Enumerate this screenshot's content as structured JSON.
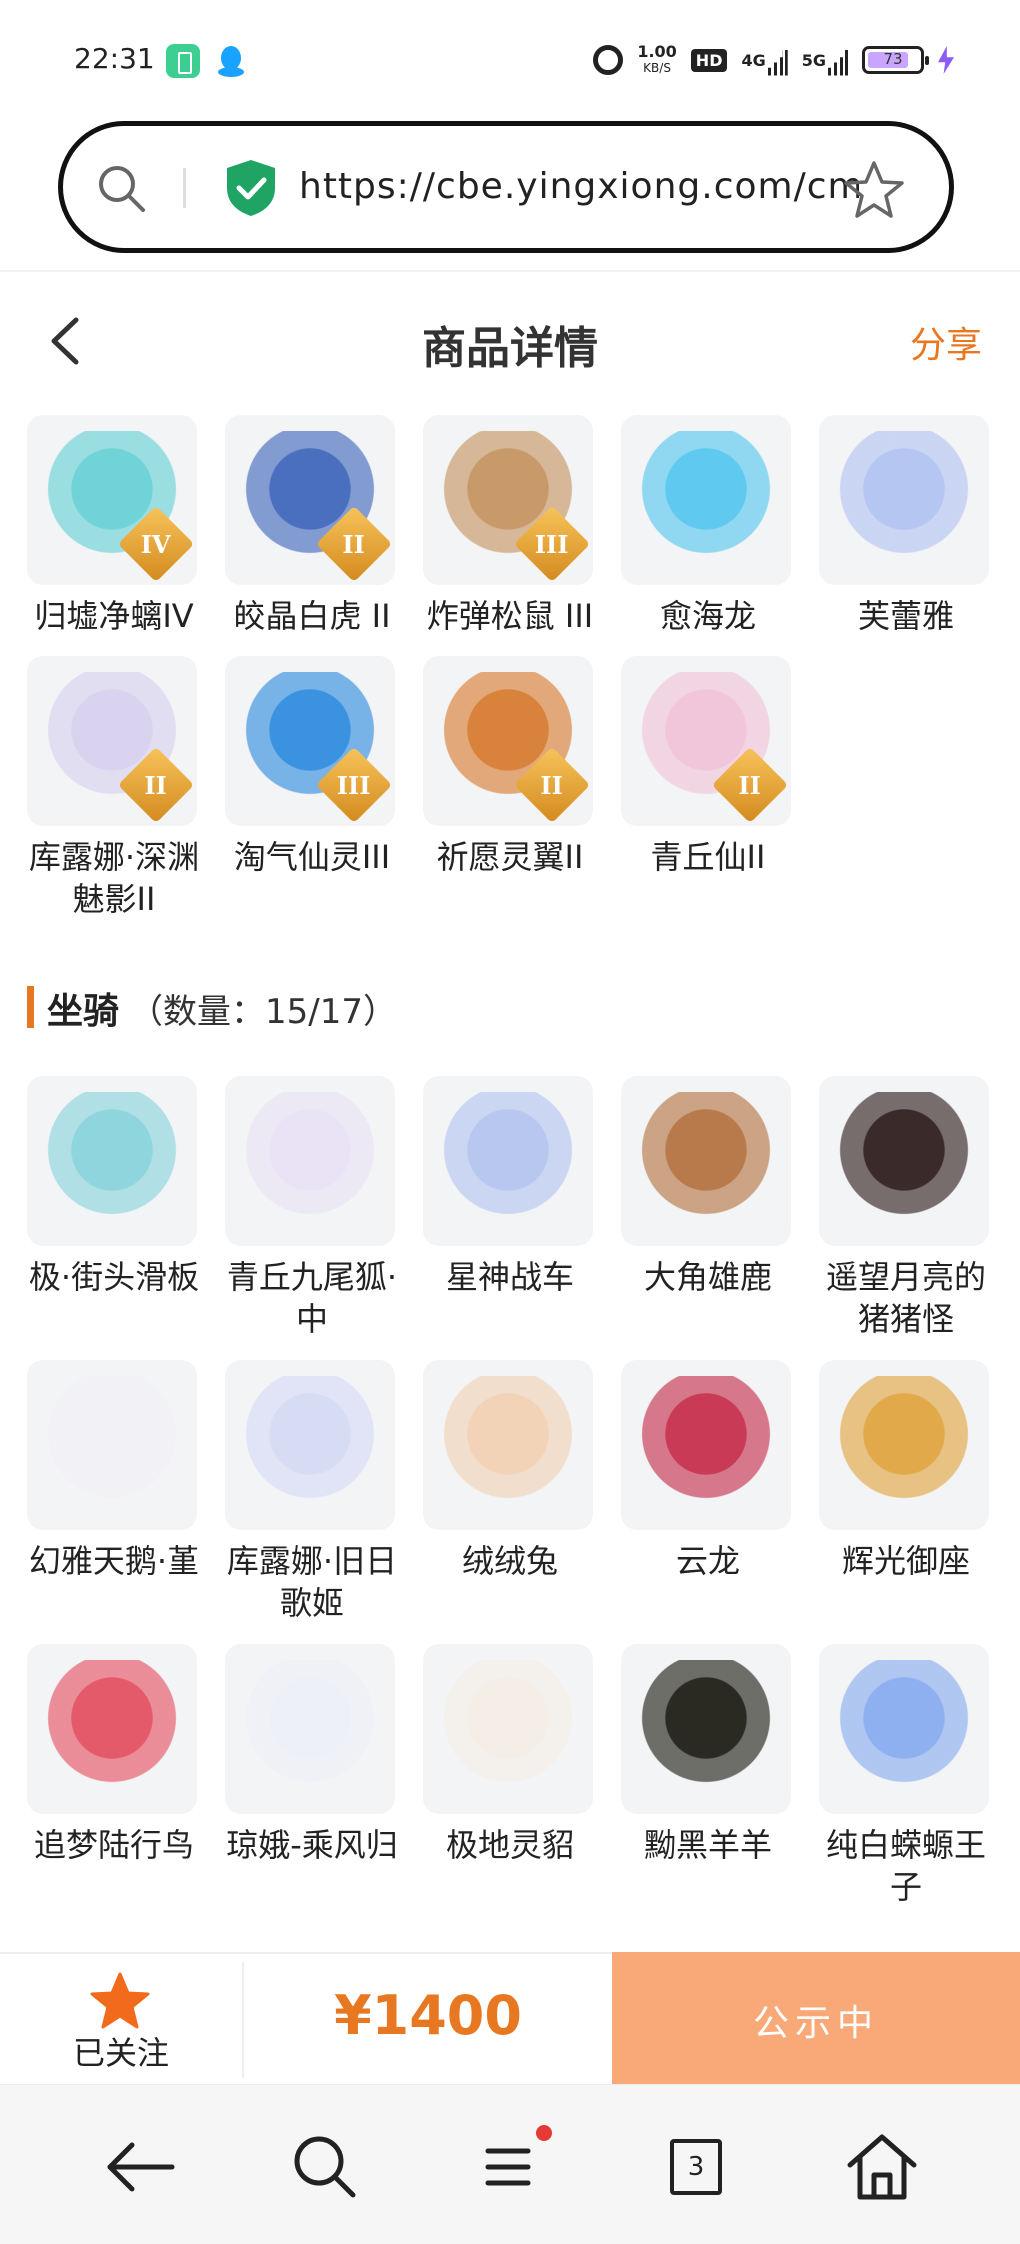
{
  "status_bar": {
    "time": "22:31",
    "speed_value": "1.00",
    "speed_unit": "KB/S",
    "hd_label": "HD",
    "net1": "4G",
    "net2": "5G",
    "battery": "73"
  },
  "url_bar": {
    "url": "https://cbe.yingxiong.com/cm/···"
  },
  "header": {
    "title": "商品详情",
    "share_label": "分享"
  },
  "pets": [
    {
      "name": "归墟净螭IV",
      "tier": "IV",
      "icon": "cyan-dragon",
      "color": "#6fd3d8"
    },
    {
      "name": "皎晶白虎 II",
      "tier": "II",
      "icon": "white-tiger",
      "color": "#4a6fbf"
    },
    {
      "name": "炸弹松鼠 III",
      "tier": "III",
      "icon": "bomb-squirrel",
      "color": "#c89a6a"
    },
    {
      "name": "愈海龙",
      "tier": "",
      "icon": "sea-dragon",
      "color": "#5fc9ef"
    },
    {
      "name": "芙蕾雅",
      "tier": "",
      "icon": "freya-doll",
      "color": "#b6c6f2"
    },
    {
      "name": "库露娜·深渊魅影II",
      "tier": "II",
      "icon": "kuluna-doll",
      "color": "#d9d3f0"
    },
    {
      "name": "淘气仙灵III",
      "tier": "III",
      "icon": "blue-puppy",
      "color": "#3b92e0"
    },
    {
      "name": "祈愿灵翼II",
      "tier": "II",
      "icon": "eagle",
      "color": "#d9823c"
    },
    {
      "name": "青丘仙II",
      "tier": "II",
      "icon": "fox-fairy",
      "color": "#f2c6da"
    }
  ],
  "mounts_section": {
    "title": "坐骑",
    "count": "（数量：15/17）"
  },
  "mounts": [
    {
      "name": "极·街头滑板",
      "icon": "skateboard",
      "color": "#8fd5de"
    },
    {
      "name": "青丘九尾狐·中",
      "icon": "nine-tail-fox",
      "color": "#e9e3f5"
    },
    {
      "name": "星神战车",
      "icon": "star-chariot",
      "color": "#b7c7f0"
    },
    {
      "name": "大角雄鹿",
      "icon": "stag",
      "color": "#b87a4b"
    },
    {
      "name": "遥望月亮的猪猪怪",
      "icon": "moon-pig",
      "color": "#3a2a2a"
    },
    {
      "name": "幻雅天鹅·堇",
      "icon": "swan",
      "color": "#f1f1f6"
    },
    {
      "name": "库露娜·旧日歌姬",
      "icon": "kuluna-singer",
      "color": "#d7dcf5"
    },
    {
      "name": "绒绒兔",
      "icon": "fluffy-rabbit",
      "color": "#f2d3b8"
    },
    {
      "name": "云龙",
      "icon": "cloud-dragon",
      "color": "#c83a55"
    },
    {
      "name": "辉光御座",
      "icon": "glow-throne",
      "color": "#e2a94a"
    },
    {
      "name": "追梦陆行鸟",
      "icon": "dream-bird",
      "color": "#e55a6a"
    },
    {
      "name": "琼娥-乘风归",
      "icon": "qiong-e",
      "color": "#eef0f8"
    },
    {
      "name": "极地灵貂",
      "icon": "polar-mink",
      "color": "#f4eee6"
    },
    {
      "name": "黝黑羊羊",
      "icon": "black-sheep",
      "color": "#2a2a22"
    },
    {
      "name": "纯白蝾螈王子",
      "icon": "axolotl-prince",
      "color": "#8fb0f0"
    }
  ],
  "action_bar": {
    "follow_label": "已关注",
    "price": "¥1400",
    "status_label": "公示中"
  },
  "nav": {
    "tabs_count": "3"
  },
  "colors": {
    "accent": "#e87722",
    "status_button": "#f9a978",
    "secure_green": "#1fa463"
  }
}
